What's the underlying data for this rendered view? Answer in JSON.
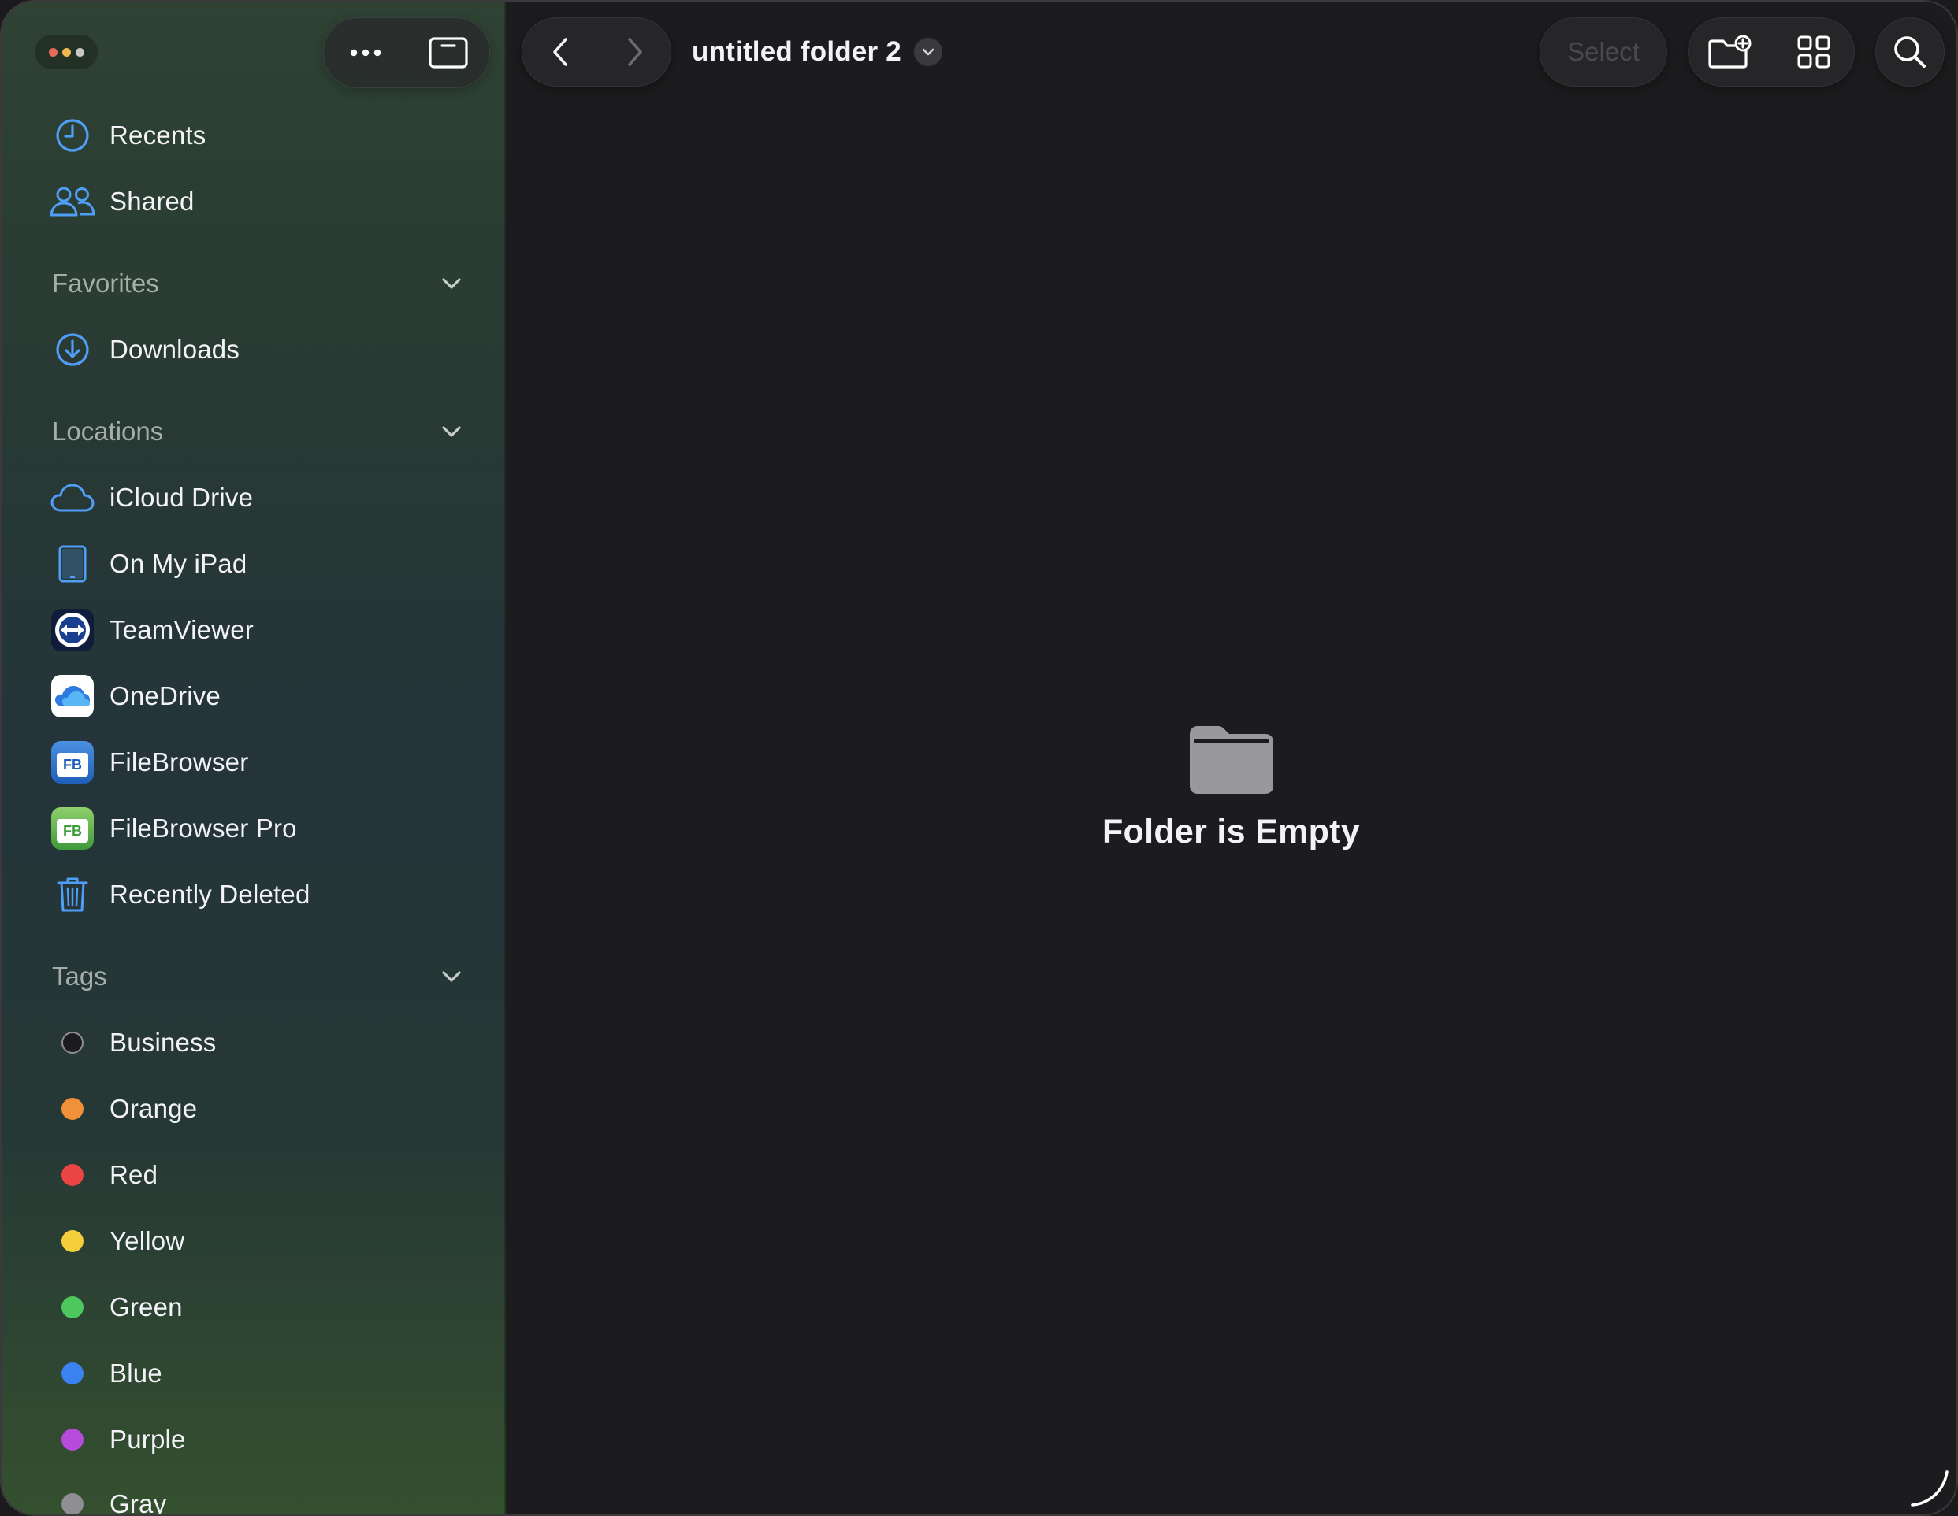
{
  "window": {
    "title": "untitled folder 2"
  },
  "toolbar": {
    "select_label": "Select",
    "icons": {
      "more": "ellipsis-icon",
      "sidebar_toggle": "sidebar-icon",
      "back": "chevron-left-icon",
      "forward": "chevron-right-icon",
      "title_menu": "chevron-down-icon",
      "new_folder": "folder-plus-icon",
      "view": "grid-icon",
      "search": "search-icon"
    }
  },
  "sidebar": {
    "top_items": [
      {
        "label": "Recents",
        "icon": "clock-icon"
      },
      {
        "label": "Shared",
        "icon": "people-icon"
      }
    ],
    "favorites": {
      "header": "Favorites",
      "items": [
        {
          "label": "Downloads",
          "icon": "download-icon"
        }
      ]
    },
    "locations": {
      "header": "Locations",
      "items": [
        {
          "label": "iCloud Drive",
          "icon": "cloud-icon"
        },
        {
          "label": "On My iPad",
          "icon": "ipad-icon"
        },
        {
          "label": "TeamViewer",
          "icon": "teamviewer-icon"
        },
        {
          "label": "OneDrive",
          "icon": "onedrive-icon"
        },
        {
          "label": "FileBrowser",
          "icon": "filebrowser-icon",
          "badge": "FB"
        },
        {
          "label": "FileBrowser Pro",
          "icon": "filebrowser-pro-icon",
          "badge": "FB"
        },
        {
          "label": "Recently Deleted",
          "icon": "trash-icon"
        }
      ]
    },
    "tags": {
      "header": "Tags",
      "items": [
        {
          "label": "Business",
          "color": "#1c1c1e",
          "ring": "#8e8e93"
        },
        {
          "label": "Orange",
          "color": "#f0913a"
        },
        {
          "label": "Red",
          "color": "#eb4444"
        },
        {
          "label": "Yellow",
          "color": "#f5cf3b"
        },
        {
          "label": "Green",
          "color": "#4cc85c"
        },
        {
          "label": "Blue",
          "color": "#3a82f0"
        },
        {
          "label": "Purple",
          "color": "#b64bdc"
        },
        {
          "label": "Gray",
          "color": "#8e8e93"
        }
      ]
    }
  },
  "main": {
    "empty_state": {
      "icon": "folder-icon",
      "message": "Folder is Empty"
    }
  },
  "colors": {
    "accent": "#4f9ef8",
    "window_dot_1": "#e86a5c",
    "window_dot_2": "#f0b84a",
    "window_dot_3": "#c9c9c9"
  }
}
